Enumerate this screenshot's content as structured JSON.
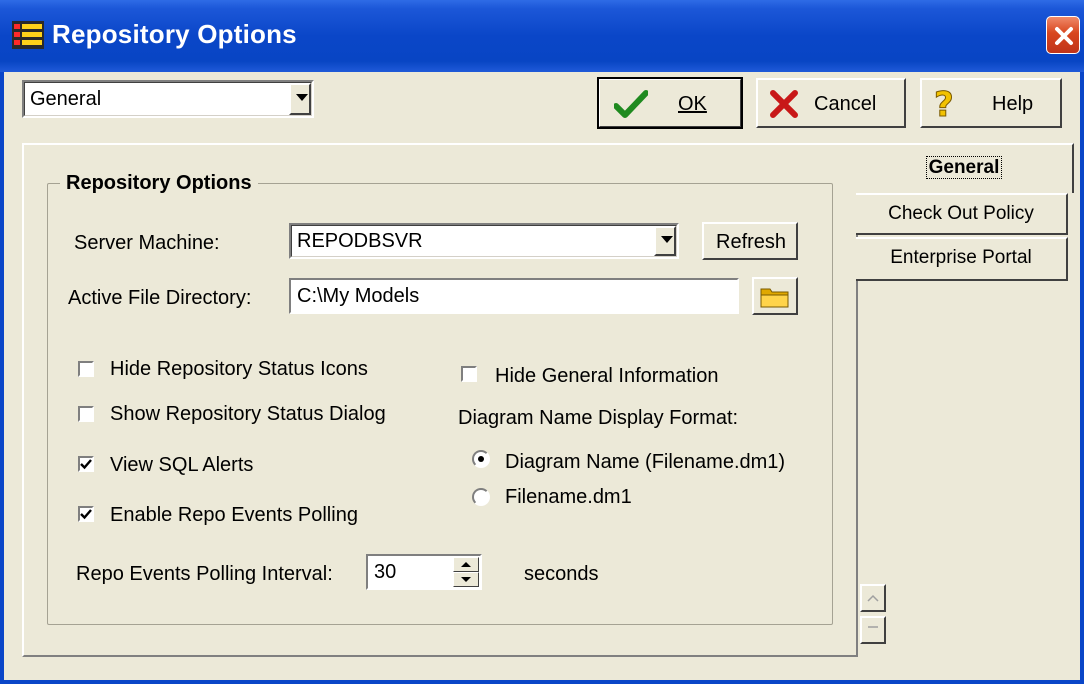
{
  "window": {
    "title": "Repository Options"
  },
  "toolbar": {
    "page_select_value": "General",
    "ok_label": "OK",
    "cancel_label": "Cancel",
    "help_label": "Help"
  },
  "tabs": [
    "General",
    "Check Out Policy",
    "Enterprise Portal"
  ],
  "group": {
    "title": "Repository Options",
    "server_label": "Server Machine:",
    "server_value": "REPODBSVR",
    "refresh_label": "Refresh",
    "active_dir_label": "Active File Directory:",
    "active_dir_value": "C:\\My Models",
    "checkboxes": [
      {
        "label": "Hide Repository Status Icons",
        "checked": false
      },
      {
        "label": "Show Repository Status Dialog",
        "checked": false
      },
      {
        "label": "View SQL Alerts",
        "checked": true
      },
      {
        "label": "Enable Repo Events Polling",
        "checked": true
      },
      {
        "label": "Hide General Information",
        "checked": false
      }
    ],
    "diagram_format_label": "Diagram Name Display Format:",
    "radios": [
      {
        "label": "Diagram Name (Filename.dm1)",
        "selected": true
      },
      {
        "label": "Filename.dm1",
        "selected": false
      }
    ],
    "interval_label": "Repo Events Polling Interval:",
    "interval_value": "30",
    "interval_unit": "seconds"
  }
}
